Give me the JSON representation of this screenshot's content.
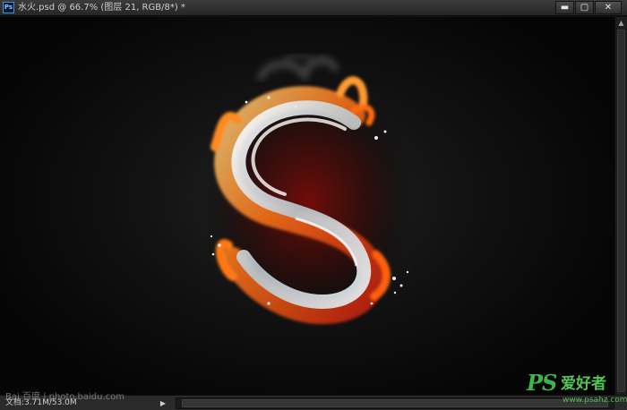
{
  "app": {
    "icon_label": "Ps",
    "document_title": "水火.psd @ 66.7% (图层 21, RGB/8*) *"
  },
  "window_controls": {
    "minimize": "▬",
    "maximize": "▢",
    "close": "✕"
  },
  "artwork": {
    "subject": "letter S formed of water and fire",
    "letter": "S"
  },
  "status": {
    "doc_info": "文档:3.71M/53.0M",
    "nav_arrow": "▶"
  },
  "scrollbar": {
    "up_arrow": "▲"
  },
  "watermark": {
    "logo": "PS",
    "cn_text": "爱好者",
    "url": "www.psahz.com",
    "baidu": "Bai 百度 | photo.baidu.com"
  },
  "colors": {
    "fire_orange": "#ff7a1a",
    "fire_red": "#c81e0a",
    "water_silver": "#e8eef2",
    "watermark_green": "#3fb44a"
  }
}
